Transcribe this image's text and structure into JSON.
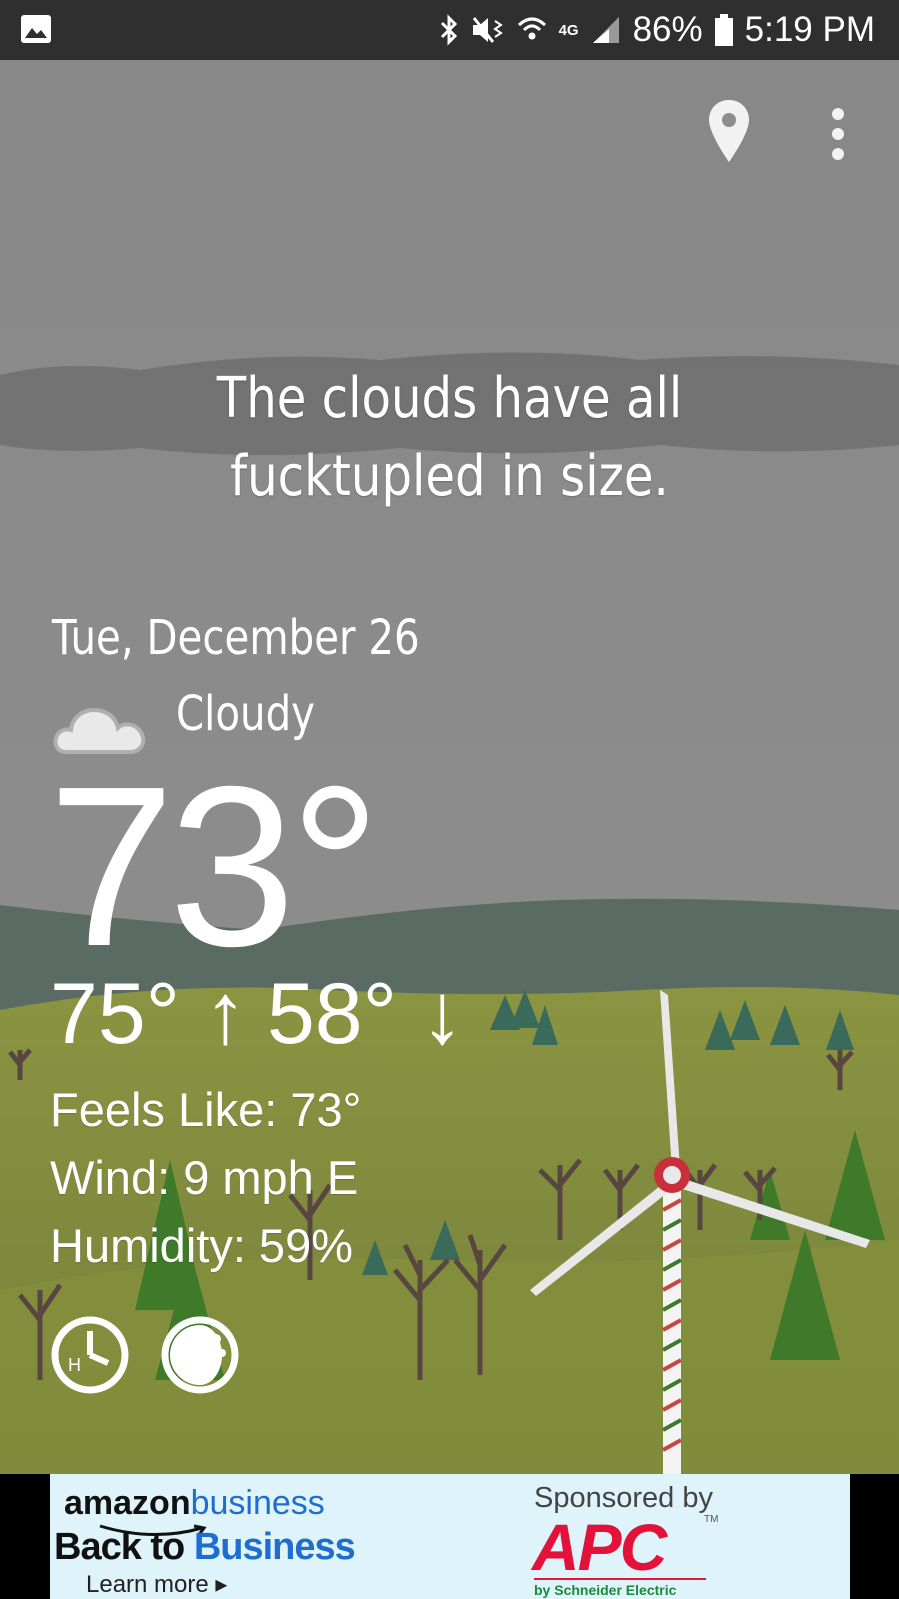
{
  "status_bar": {
    "battery_percent": "86%",
    "time": "5:19 PM",
    "network": "4G",
    "icons": [
      "gallery-icon",
      "bluetooth-icon",
      "mute-vibrate-icon",
      "wifi-icon",
      "signal-icon",
      "battery-icon"
    ]
  },
  "toolbar": {
    "icons": [
      "location-pin-icon",
      "overflow-menu-icon"
    ]
  },
  "weather": {
    "headline": "The clouds have all fucktupled in size.",
    "date": "Tue, December 26",
    "condition": "Cloudy",
    "condition_icon": "cloud-icon",
    "temperature": "73°",
    "high": "75° ↑",
    "low": "58° ↓",
    "feels_like": "Feels Like: 73°",
    "wind": "Wind: 9 mph E",
    "humidity": "Humidity: 59%",
    "buttons": [
      "history-icon",
      "moon-phase-icon"
    ]
  },
  "ad": {
    "brand_a": "amazon",
    "brand_b": "business",
    "headline_a": "Back to ",
    "headline_b": "Business",
    "cta": "Learn more ▸",
    "sponsored": "Sponsored by",
    "sponsor_logo": "APC",
    "sponsor_tagline": "by Schneider Electric",
    "colors": {
      "amazon_blue": "#1f6ecf",
      "apc_red": "#e3123b",
      "schneider_green": "#1b8a3b"
    }
  },
  "theme": {
    "sky": "#8e8e8e",
    "cloud_band": "#6f6f6f",
    "hill_far": "#5a6a62",
    "grass": "#7f8a3a",
    "text": "#ffffff"
  }
}
